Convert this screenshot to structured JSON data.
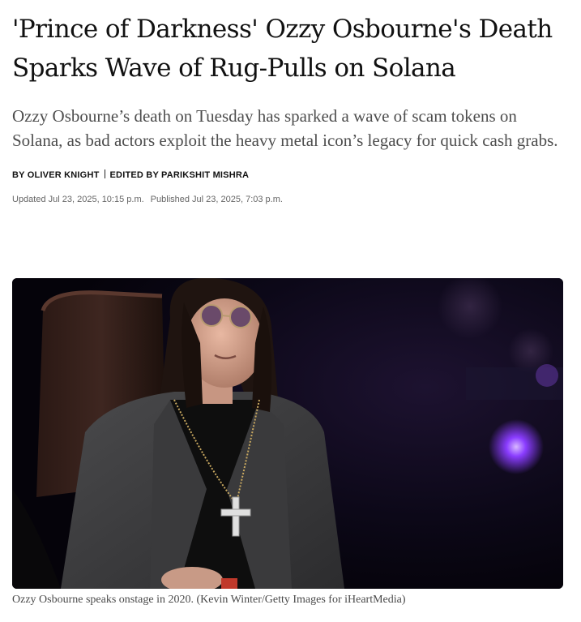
{
  "article": {
    "headline": "'Prince of Darkness' Ozzy Osbourne's Death Sparks Wave of Rug-Pulls on Solana",
    "dek": "Ozzy Osbourne’s death on Tuesday has sparked a wave of scam tokens on Solana, as bad actors exploit the heavy metal icon’s legacy for quick cash grabs.",
    "byline": {
      "author": "BY OLIVER KNIGHT",
      "editor": "EDITED BY PARIKSHIT MISHRA"
    },
    "dates": {
      "updated": "Updated Jul 23, 2025, 10:15 p.m.",
      "published": "Published Jul 23, 2025, 7:03 p.m."
    },
    "image": {
      "caption": "Ozzy Osbourne speaks onstage in 2020. (Kevin Winter/Getty Images for iHeartMedia)"
    }
  },
  "colors": {
    "headline": "#111111",
    "dek": "#4d4d4d",
    "meta": "#666666",
    "stage_background": "#0a0614",
    "stage_light": "#8a3cff"
  }
}
